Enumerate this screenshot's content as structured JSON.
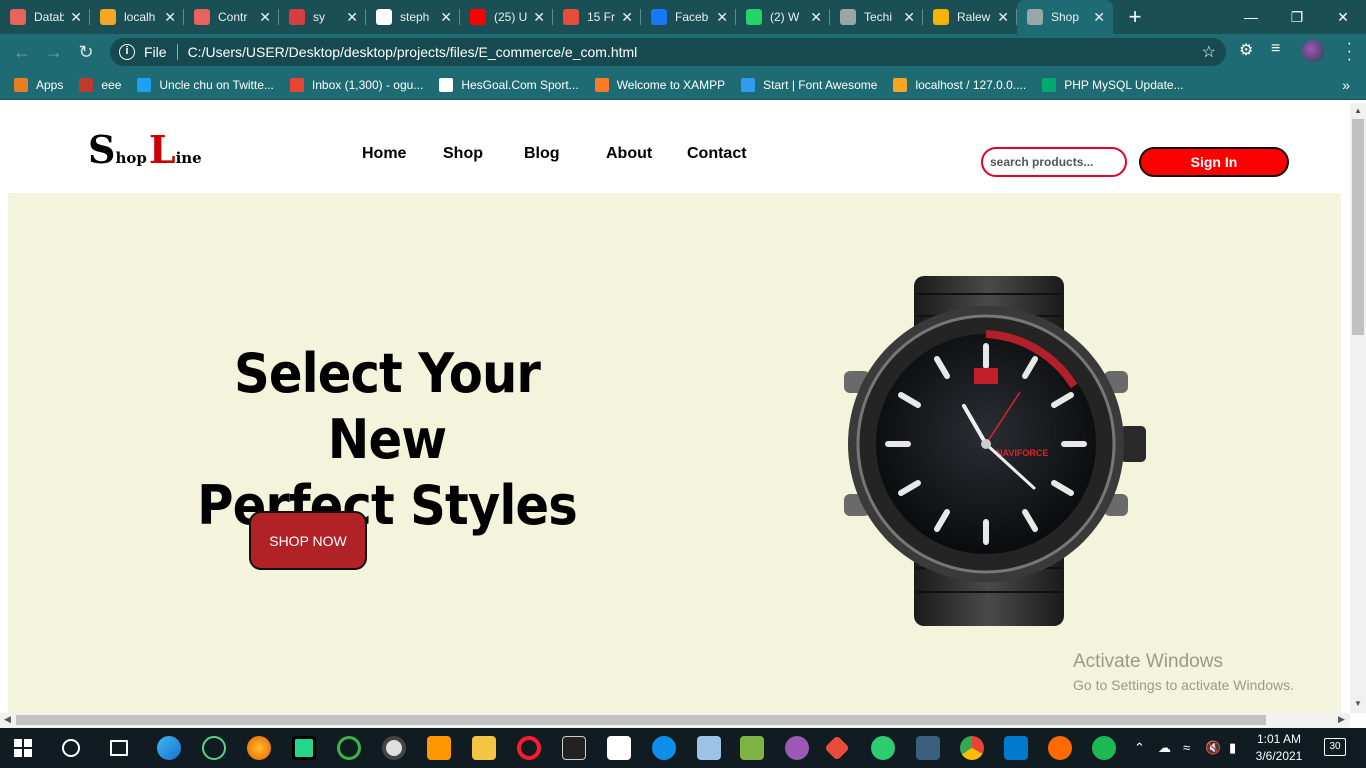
{
  "browser": {
    "tabs": [
      {
        "label": "Datab",
        "color": "#e8645b"
      },
      {
        "label": "localh",
        "color": "#f5a623"
      },
      {
        "label": "Contr",
        "color": "#e8645b"
      },
      {
        "label": "sy",
        "color": "#d63e3e"
      },
      {
        "label": "steph",
        "color": "#ffffff"
      },
      {
        "label": "(25) U",
        "color": "#ff0000"
      },
      {
        "label": "15 Fr",
        "color": "#e74c3c"
      },
      {
        "label": "Faceb",
        "color": "#1877f2"
      },
      {
        "label": "(2) W",
        "color": "#25d366"
      },
      {
        "label": "Techi",
        "color": "#9aa7a8"
      },
      {
        "label": "Ralew",
        "color": "#f4b400"
      },
      {
        "label": "Shop",
        "color": "#9aa7a8"
      }
    ],
    "active_tab_index": 11,
    "new_tab": "+",
    "address": {
      "scheme_label": "File",
      "url": "C:/Users/USER/Desktop/desktop/projects/files/E_commerce/e_com.html"
    },
    "bookmarks": [
      {
        "label": "Apps",
        "color": "#e67e22"
      },
      {
        "label": "eee",
        "color": "#c0392b"
      },
      {
        "label": "Uncle chu on Twitte...",
        "color": "#1da1f2"
      },
      {
        "label": "Inbox (1,300) - ogu...",
        "color": "#ea4335"
      },
      {
        "label": "HesGoal.Com Sport...",
        "color": "#ffffff"
      },
      {
        "label": "Welcome to XAMPP",
        "color": "#fb7a24"
      },
      {
        "label": "Start | Font Awesome",
        "color": "#339af0"
      },
      {
        "label": "localhost / 127.0.0....",
        "color": "#f5a623"
      },
      {
        "label": "PHP MySQL Update...",
        "color": "#04aa6d"
      }
    ]
  },
  "site": {
    "logo": {
      "s": "S",
      "hop": "hop",
      "l": "L",
      "ine": "ine"
    },
    "nav": [
      "Home",
      "Shop",
      "Blog",
      "About",
      "Contact"
    ],
    "search_placeholder": "search products...",
    "signin_label": "Sign In",
    "hero": {
      "line1": "Select Your New",
      "line2": "Perfect Styles",
      "cta": "SHOP NOW",
      "product_brand": "NAVIFORCE"
    }
  },
  "overlay": {
    "activate_title": "Activate Windows",
    "activate_sub": "Go to Settings to activate Windows."
  },
  "taskbar": {
    "time": "1:01 AM",
    "date": "3/6/2021",
    "notifications": "30"
  },
  "colors": {
    "chrome_dark": "#1a4f55",
    "chrome": "#1e6b73",
    "hero_bg": "#f4f4dc",
    "accent_red": "#ff0000",
    "cta_red": "#b02226"
  }
}
